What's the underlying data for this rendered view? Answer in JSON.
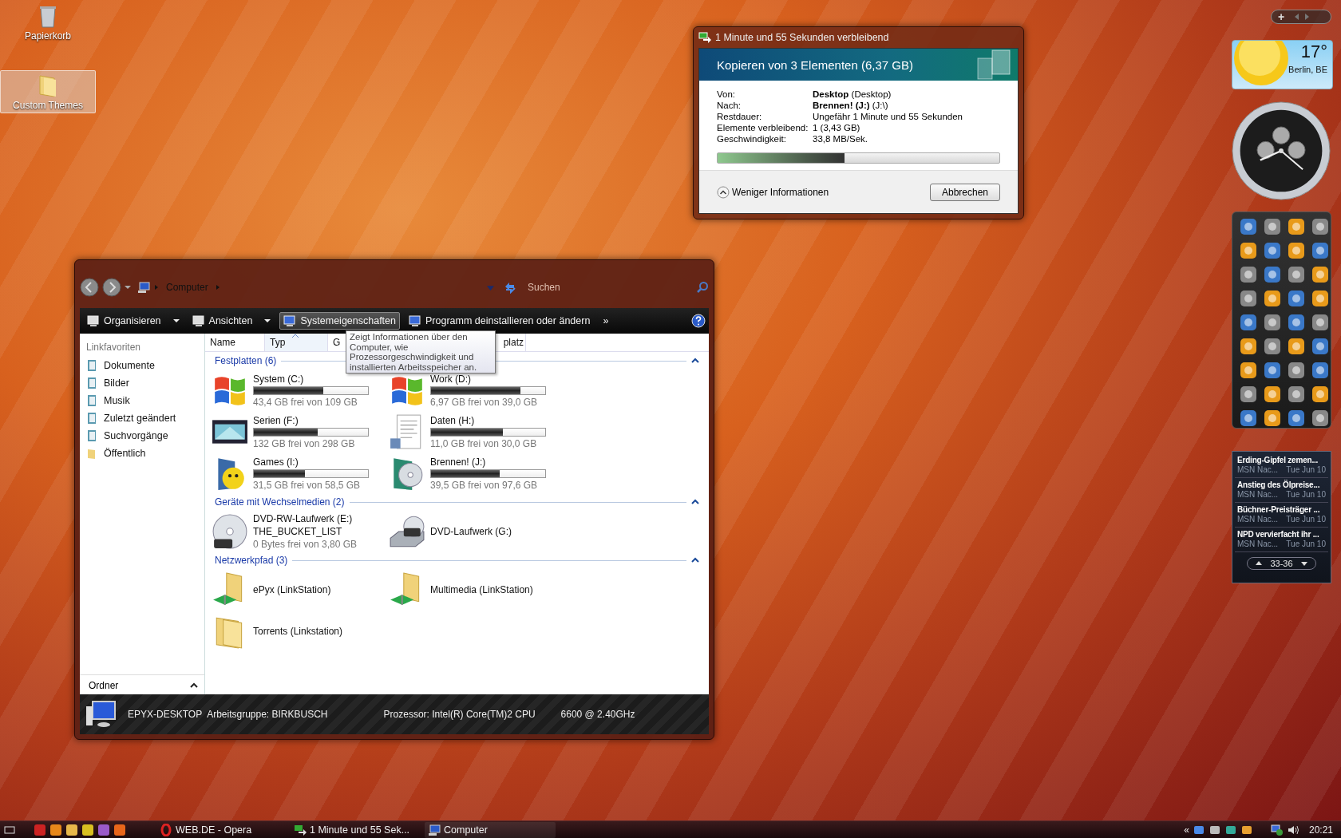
{
  "desktop_icons": [
    {
      "label": "Papierkorb",
      "kind": "bin",
      "selected": false
    },
    {
      "label": "Custom Themes",
      "kind": "folder",
      "selected": true
    }
  ],
  "copy_dialog": {
    "title": "1 Minute und 55 Sekunden verbleibend",
    "heading": "Kopieren von 3 Elementen (6,37 GB)",
    "details": [
      {
        "label": "Von:",
        "value": "**Desktop** (Desktop)"
      },
      {
        "label": "Nach:",
        "value": "**Brennen! (J:)** (J:\\)"
      },
      {
        "label": "Restdauer:",
        "value": "Ungefähr 1 Minute und 55 Sekunden"
      },
      {
        "label": "Elemente verbleibend:",
        "value": "1 (3,43 GB)"
      },
      {
        "label": "Geschwindigkeit:",
        "value": "33,8 MB/Sek."
      }
    ],
    "progress": {
      "level": 0.45
    },
    "toggle_label": "Weniger Informationen",
    "cancel_button": "Abbrechen"
  },
  "explorer": {
    "breadcrumb": "Computer",
    "search": {
      "placeholder": "Suchen"
    },
    "toolbar": [
      {
        "label": "Organisieren",
        "kind": "menu",
        "highlighted": false
      },
      {
        "label": "Ansichten",
        "kind": "menu",
        "highlighted": false
      },
      {
        "label": "Systemeigenschaften",
        "kind": "button",
        "highlighted": true
      },
      {
        "label": "Programm deinstallieren oder ändern",
        "kind": "button",
        "highlighted": false
      },
      {
        "label": "»",
        "kind": "more",
        "highlighted": false
      }
    ],
    "tooltip": "Zeigt Informationen über den Computer, wie Prozessorgeschwindigkeit und installierten Arbeitsspeicher an.",
    "favorites_heading": "Linkfavoriten",
    "favorites": [
      {
        "label": "Dokumente",
        "kind": "doc"
      },
      {
        "label": "Bilder",
        "kind": "doc"
      },
      {
        "label": "Musik",
        "kind": "music"
      },
      {
        "label": "Zuletzt geändert",
        "kind": "recent"
      },
      {
        "label": "Suchvorgänge",
        "kind": "search"
      },
      {
        "label": "Öffentlich",
        "kind": "folder"
      }
    ],
    "folders_label": "Ordner",
    "columns": [
      {
        "label": "Name",
        "sorted": false
      },
      {
        "label": "Typ",
        "sorted": true
      },
      {
        "label": "G",
        "sorted": false
      },
      {
        "label": "platz",
        "sorted": false
      }
    ],
    "groups": [
      {
        "title": "Festplatten (6)",
        "expanded": true,
        "items": [
          {
            "name": "System (C:)",
            "kind": "windows",
            "level": 0.61,
            "free": "43,4 GB frei von 109 GB"
          },
          {
            "name": "Work (D:)",
            "kind": "windows",
            "level": 0.78,
            "free": "6,97 GB frei von 39,0 GB"
          },
          {
            "name": "Serien (F:)",
            "kind": "film",
            "level": 0.56,
            "free": "132 GB frei von 298 GB"
          },
          {
            "name": "Daten (H:)",
            "kind": "document",
            "level": 0.63,
            "free": "11,0 GB frei von 30,0 GB"
          },
          {
            "name": "Games (I:)",
            "kind": "smiley",
            "level": 0.45,
            "free": "31,5 GB frei von 58,5 GB"
          },
          {
            "name": "Brennen! (J:)",
            "kind": "disc",
            "level": 0.6,
            "free": "39,5 GB frei von 97,6 GB"
          }
        ]
      },
      {
        "title": "Geräte mit Wechselmedien (2)",
        "expanded": true,
        "items": [
          {
            "name": "DVD-RW-Laufwerk (E:)",
            "kind": "dvd",
            "sub": "THE_BUCKET_LIST",
            "free": "0 Bytes frei von 3,80 GB"
          },
          {
            "name": "DVD-Laufwerk (G:)",
            "kind": "dvd-drive"
          }
        ]
      },
      {
        "title": "Netzwerkpfad (3)",
        "expanded": true,
        "items": [
          {
            "name": "ePyx (LinkStation)",
            "kind": "network-folder"
          },
          {
            "name": "Multimedia (LinkStation)",
            "kind": "network-folder"
          },
          {
            "name": "Torrents (Linkstation)",
            "kind": "folder"
          }
        ]
      }
    ],
    "status": [
      {
        "label": "EPYX-DESKTOP"
      },
      {
        "label": "Arbeitsgruppe:  BIRKBUSCH"
      },
      {
        "label": "Prozessor:  Intel(R) Core(TM)2 CPU"
      },
      {
        "label": "6600  @ 2.40GHz"
      }
    ]
  },
  "weather": {
    "temperature": "17°",
    "city": "Berlin, BE"
  },
  "news": {
    "items": [
      {
        "headline": "Erding-Gipfel zemen...",
        "source": "MSN Nac...",
        "date": "Tue Jun 10"
      },
      {
        "headline": "Anstieg des Ölpreise...",
        "source": "MSN Nac...",
        "date": "Tue Jun 10"
      },
      {
        "headline": "Büchner-Preisträger ...",
        "source": "MSN Nac...",
        "date": "Tue Jun 10"
      },
      {
        "headline": "NPD vervierfacht ihr ...",
        "source": "MSN Nac...",
        "date": "Tue Jun 10"
      }
    ],
    "pager": "33-36"
  },
  "gadget_bar": {
    "add": "+"
  },
  "taskbar": {
    "tasks": [
      {
        "label": "WEB.DE - Opera",
        "kind": "browser",
        "active": false
      },
      {
        "label": "1 Minute und 55 Sek...",
        "kind": "copy",
        "active": false
      },
      {
        "label": "Computer",
        "kind": "computer",
        "active": true
      }
    ],
    "tray_toggle": "«",
    "clock": "20:21"
  }
}
